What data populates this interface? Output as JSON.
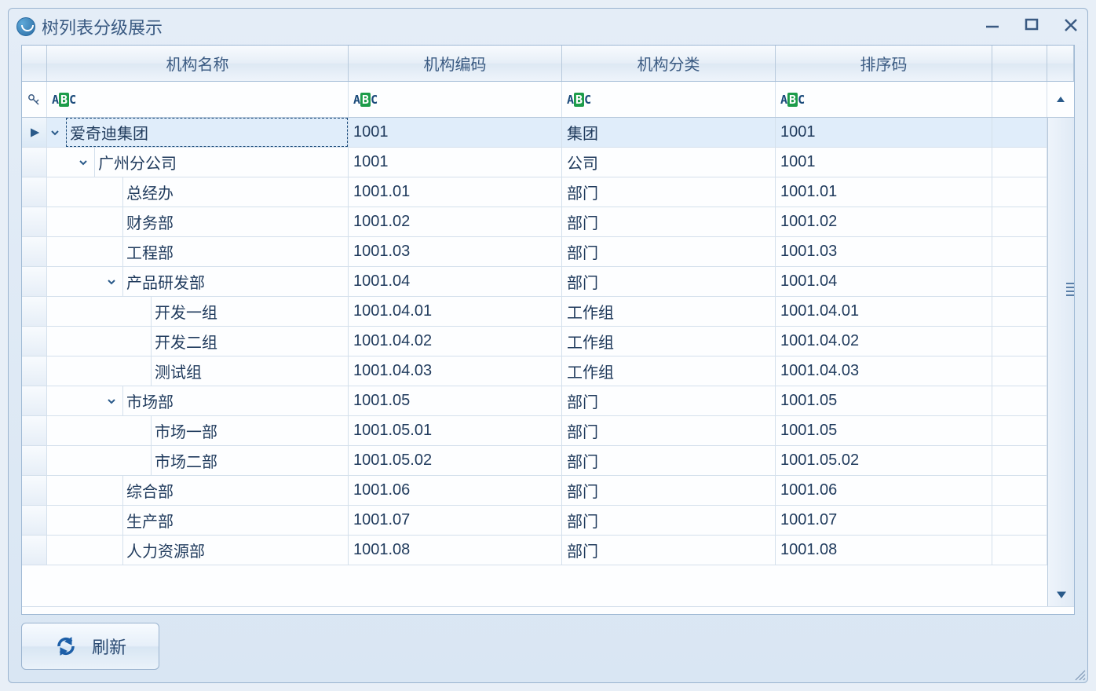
{
  "window": {
    "title": "树列表分级展示"
  },
  "columns": {
    "name": "机构名称",
    "code": "机构编码",
    "category": "机构分类",
    "sort": "排序码"
  },
  "filter_glyph": {
    "a": "A",
    "b": "B",
    "c": "C"
  },
  "rows": [
    {
      "level": 0,
      "expandable": true,
      "selected": true,
      "name": "爱奇迪集团",
      "code": "1001",
      "category": "集团",
      "sort": "1001"
    },
    {
      "level": 1,
      "expandable": true,
      "name": "广州分公司",
      "code": "1001",
      "category": "公司",
      "sort": "1001"
    },
    {
      "level": 2,
      "expandable": false,
      "name": "总经办",
      "code": "1001.01",
      "category": "部门",
      "sort": "1001.01"
    },
    {
      "level": 2,
      "expandable": false,
      "name": "财务部",
      "code": "1001.02",
      "category": "部门",
      "sort": "1001.02"
    },
    {
      "level": 2,
      "expandable": false,
      "name": "工程部",
      "code": "1001.03",
      "category": "部门",
      "sort": "1001.03"
    },
    {
      "level": 2,
      "expandable": true,
      "name": "产品研发部",
      "code": "1001.04",
      "category": "部门",
      "sort": "1001.04"
    },
    {
      "level": 3,
      "expandable": false,
      "name": "开发一组",
      "code": "1001.04.01",
      "category": "工作组",
      "sort": "1001.04.01"
    },
    {
      "level": 3,
      "expandable": false,
      "name": "开发二组",
      "code": "1001.04.02",
      "category": "工作组",
      "sort": "1001.04.02"
    },
    {
      "level": 3,
      "expandable": false,
      "name": "测试组",
      "code": "1001.04.03",
      "category": "工作组",
      "sort": "1001.04.03"
    },
    {
      "level": 2,
      "expandable": true,
      "name": "市场部",
      "code": "1001.05",
      "category": "部门",
      "sort": "1001.05"
    },
    {
      "level": 3,
      "expandable": false,
      "name": "市场一部",
      "code": "1001.05.01",
      "category": "部门",
      "sort": "1001.05"
    },
    {
      "level": 3,
      "expandable": false,
      "name": "市场二部",
      "code": "1001.05.02",
      "category": "部门",
      "sort": "1001.05.02"
    },
    {
      "level": 2,
      "expandable": false,
      "name": "综合部",
      "code": "1001.06",
      "category": "部门",
      "sort": "1001.06"
    },
    {
      "level": 2,
      "expandable": false,
      "name": "生产部",
      "code": "1001.07",
      "category": "部门",
      "sort": "1001.07"
    },
    {
      "level": 2,
      "expandable": false,
      "name": "人力资源部",
      "code": "1001.08",
      "category": "部门",
      "sort": "1001.08"
    }
  ],
  "buttons": {
    "refresh": "刷新"
  }
}
